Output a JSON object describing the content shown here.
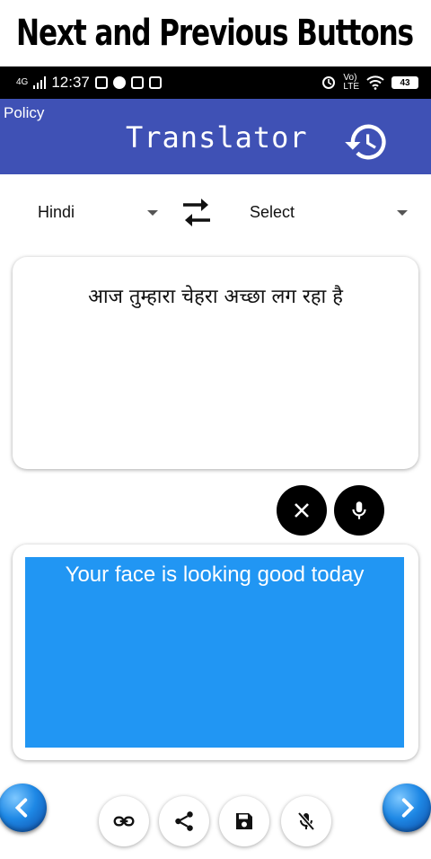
{
  "banner": {
    "title": "Next and Previous Buttons"
  },
  "status_bar": {
    "network": "4G",
    "time": "12:37",
    "volte_top": "Vo)",
    "volte_bottom": "LTE",
    "battery": "43"
  },
  "app_bar": {
    "policy_label": "Policy",
    "title": "Translator",
    "history_icon": "history-icon"
  },
  "languages": {
    "source": "Hindi",
    "target": "Select",
    "swap_icon": "swap-icon"
  },
  "input": {
    "text": "आज तुम्हारा चेहरा अच्छा लग रहा है"
  },
  "output": {
    "text": "Your face is looking good today",
    "background": "#2196f3"
  },
  "actions": {
    "clear_icon": "close-icon",
    "mic_icon": "mic-icon",
    "tools": [
      "link-icon",
      "share-icon",
      "save-icon",
      "mic-off-icon"
    ]
  },
  "navigation": {
    "prev_icon": "chevron-left-icon",
    "next_icon": "chevron-right-icon"
  },
  "colors": {
    "app_bar": "#3f51b5",
    "nav_button": "#1e88e5"
  }
}
